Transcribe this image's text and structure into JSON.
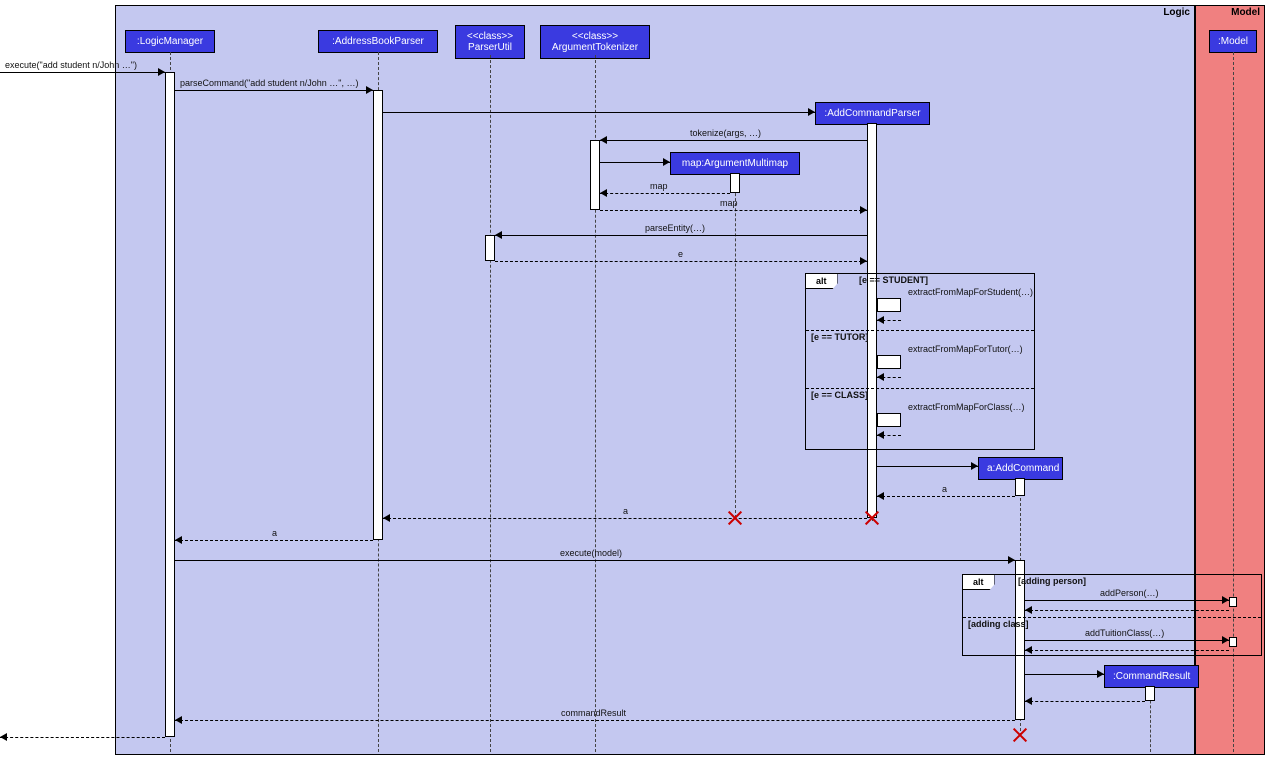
{
  "regions": {
    "logic": "Logic",
    "model": "Model"
  },
  "participants": {
    "logic_manager": ":LogicManager",
    "addr_parser": ":AddressBookParser",
    "parser_util": "<<class>>\nParserUtil",
    "arg_tokenizer": "<<class>>\nArgumentTokenizer",
    "add_cmd_parser": ":AddCommandParser",
    "arg_multimap": "map:ArgumentMultimap",
    "add_command": "a:AddCommand",
    "cmd_result": ":CommandResult",
    "model": ":Model"
  },
  "messages": {
    "execute_in": "execute(\"add student n/John …\")",
    "parse_command": "parseCommand(\"add student n/John …\", …)",
    "tokenize": "tokenize(args, …)",
    "map_return_1": "map",
    "map_return_2": "map",
    "parse_entity": "parseEntity(…)",
    "entity_return": "e",
    "extract_student": "extractFromMapForStudent(…)",
    "extract_tutor": "extractFromMapForTutor(…)",
    "extract_class": "extractFromMapForClass(…)",
    "a_return_1": "a",
    "a_return_2": "a",
    "a_return_3": "a",
    "execute_model": "execute(model)",
    "add_person": "addPerson(…)",
    "add_class": "addTuitionClass(…)",
    "cmd_result_return": "commandResult"
  },
  "frames": {
    "alt1": {
      "label": "alt",
      "guards": {
        "student": "[e == STUDENT]",
        "tutor": "[e == TUTOR]",
        "class": "[e == CLASS]"
      }
    },
    "alt2": {
      "label": "alt",
      "guards": {
        "person": "[adding person]",
        "class": "[adding class]"
      }
    }
  },
  "chart_data": {
    "type": "sequence_diagram",
    "frames": [
      {
        "name": "Logic",
        "kind": "package"
      },
      {
        "name": "Model",
        "kind": "package"
      }
    ],
    "participants": [
      {
        "id": "LogicManager",
        "label": ":LogicManager",
        "frame": "Logic"
      },
      {
        "id": "AddressBookParser",
        "label": ":AddressBookParser",
        "frame": "Logic"
      },
      {
        "id": "ParserUtil",
        "label": "<<class>> ParserUtil",
        "frame": "Logic",
        "static": true
      },
      {
        "id": "ArgumentTokenizer",
        "label": "<<class>> ArgumentTokenizer",
        "frame": "Logic",
        "static": true
      },
      {
        "id": "AddCommandParser",
        "label": ":AddCommandParser",
        "frame": "Logic",
        "created": true
      },
      {
        "id": "ArgumentMultimap",
        "label": "map:ArgumentMultimap",
        "frame": "Logic",
        "created": true
      },
      {
        "id": "AddCommand",
        "label": "a:AddCommand",
        "frame": "Logic",
        "created": true
      },
      {
        "id": "CommandResult",
        "label": ":CommandResult",
        "frame": "Logic",
        "created": true
      },
      {
        "id": "Model",
        "label": ":Model",
        "frame": "Model"
      }
    ],
    "interactions": [
      {
        "from": "caller",
        "to": "LogicManager",
        "msg": "execute(\"add student n/John …\")",
        "kind": "sync"
      },
      {
        "from": "LogicManager",
        "to": "AddressBookParser",
        "msg": "parseCommand(\"add student n/John …\", …)",
        "kind": "sync"
      },
      {
        "from": "AddressBookParser",
        "to": "AddCommandParser",
        "msg": "<<create>>",
        "kind": "create"
      },
      {
        "from": "AddCommandParser",
        "to": "ArgumentTokenizer",
        "msg": "tokenize(args, …)",
        "kind": "sync"
      },
      {
        "from": "ArgumentTokenizer",
        "to": "ArgumentMultimap",
        "msg": "<<create>>",
        "kind": "create"
      },
      {
        "from": "ArgumentMultimap",
        "to": "ArgumentTokenizer",
        "msg": "map",
        "kind": "return"
      },
      {
        "from": "ArgumentTokenizer",
        "to": "AddCommandParser",
        "msg": "map",
        "kind": "return"
      },
      {
        "from": "AddCommandParser",
        "to": "ParserUtil",
        "msg": "parseEntity(…)",
        "kind": "sync"
      },
      {
        "from": "ParserUtil",
        "to": "AddCommandParser",
        "msg": "e",
        "kind": "return"
      },
      {
        "combined_fragment": "alt",
        "operands": [
          {
            "guard": "[e == STUDENT]",
            "interactions": [
              {
                "from": "AddCommandParser",
                "to": "AddCommandParser",
                "msg": "extractFromMapForStudent(…)",
                "kind": "self"
              }
            ]
          },
          {
            "guard": "[e == TUTOR]",
            "interactions": [
              {
                "from": "AddCommandParser",
                "to": "AddCommandParser",
                "msg": "extractFromMapForTutor(…)",
                "kind": "self"
              }
            ]
          },
          {
            "guard": "[e == CLASS]",
            "interactions": [
              {
                "from": "AddCommandParser",
                "to": "AddCommandParser",
                "msg": "extractFromMapForClass(…)",
                "kind": "self"
              }
            ]
          }
        ]
      },
      {
        "from": "AddCommandParser",
        "to": "AddCommand",
        "msg": "<<create>>",
        "kind": "create"
      },
      {
        "from": "AddCommand",
        "to": "AddCommandParser",
        "msg": "a",
        "kind": "return"
      },
      {
        "from": "AddCommandParser",
        "to": "AddressBookParser",
        "msg": "a",
        "kind": "return"
      },
      {
        "id": "AddCommandParser",
        "event": "destroy"
      },
      {
        "id": "ArgumentMultimap",
        "event": "destroy"
      },
      {
        "from": "AddressBookParser",
        "to": "LogicManager",
        "msg": "a",
        "kind": "return"
      },
      {
        "from": "LogicManager",
        "to": "AddCommand",
        "msg": "execute(model)",
        "kind": "sync"
      },
      {
        "combined_fragment": "alt",
        "operands": [
          {
            "guard": "[adding person]",
            "interactions": [
              {
                "from": "AddCommand",
                "to": "Model",
                "msg": "addPerson(…)",
                "kind": "sync"
              },
              {
                "from": "Model",
                "to": "AddCommand",
                "kind": "return"
              }
            ]
          },
          {
            "guard": "[adding class]",
            "interactions": [
              {
                "from": "AddCommand",
                "to": "Model",
                "msg": "addTuitionClass(…)",
                "kind": "sync"
              },
              {
                "from": "Model",
                "to": "AddCommand",
                "kind": "return"
              }
            ]
          }
        ]
      },
      {
        "from": "AddCommand",
        "to": "CommandResult",
        "msg": "<<create>>",
        "kind": "create"
      },
      {
        "from": "CommandResult",
        "to": "AddCommand",
        "kind": "return"
      },
      {
        "from": "AddCommand",
        "to": "LogicManager",
        "msg": "commandResult",
        "kind": "return"
      },
      {
        "id": "AddCommand",
        "event": "destroy"
      },
      {
        "from": "LogicManager",
        "to": "caller",
        "kind": "return"
      }
    ]
  }
}
